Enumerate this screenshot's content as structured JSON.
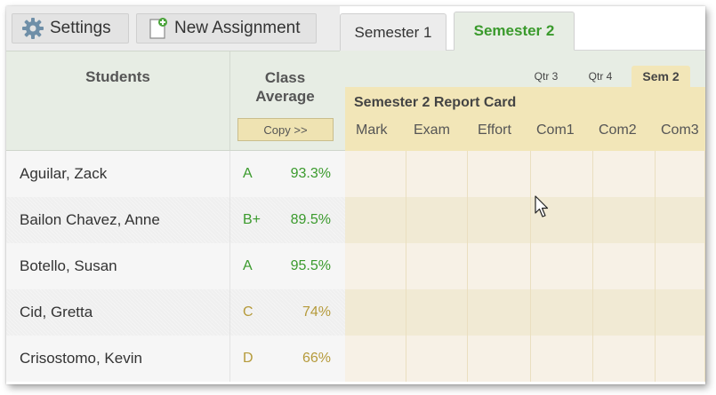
{
  "toolbar": {
    "settings_label": "Settings",
    "new_assignment_label": "New Assignment"
  },
  "tabs": [
    {
      "label": "Semester 1",
      "active": false
    },
    {
      "label": "Semester 2",
      "active": true
    }
  ],
  "header": {
    "students_label": "Students",
    "class_average_label_line1": "Class",
    "class_average_label_line2": "Average",
    "copy_label": "Copy >>"
  },
  "period_tabs": [
    {
      "label": "Qtr 3",
      "active": false
    },
    {
      "label": "Qtr 4",
      "active": false
    },
    {
      "label": "Sem 2",
      "active": true
    }
  ],
  "report_card": {
    "title": "Semester 2 Report Card",
    "columns": [
      "Mark",
      "Exam",
      "Effort",
      "Com1",
      "Com2",
      "Com3"
    ]
  },
  "students": [
    {
      "name": "Aguilar, Zack",
      "grade": "A",
      "percent": "93.3%"
    },
    {
      "name": "Bailon Chavez, Anne",
      "grade": "B+",
      "percent": "89.5%"
    },
    {
      "name": "Botello, Susan",
      "grade": "A",
      "percent": "95.5%"
    },
    {
      "name": "Cid, Gretta",
      "grade": "C",
      "percent": "74%"
    },
    {
      "name": "Crisostomo, Kevin",
      "grade": "D",
      "percent": "66%"
    }
  ],
  "colors": {
    "grade_good": "#3a9a2c",
    "grade_warn": "#b59a3a",
    "accent_green": "#3a9a2c",
    "report_card_band": "#f2e6b8"
  },
  "icons": {
    "settings": "gear-icon",
    "new_assignment": "new-document-icon",
    "cursor": "mouse-pointer-icon"
  }
}
